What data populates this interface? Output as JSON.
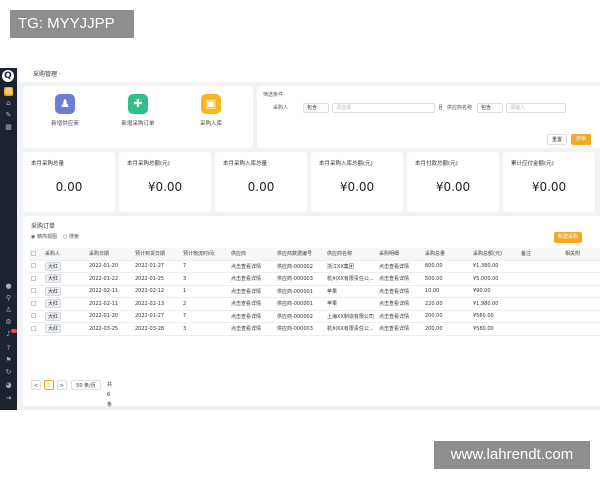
{
  "watermarks": {
    "top_left": "TG: MYYJJPP",
    "bottom_right": "www.lahrendt.com"
  },
  "colors": {
    "accent": "#f5a623",
    "rail": "#1b2230",
    "shortcut_purple": "#6c7dd4",
    "shortcut_green": "#2fbf8a",
    "shortcut_yellow": "#f5b821"
  },
  "rail_icons": [
    "logo-icon",
    "doc-icon",
    "home-icon",
    "edit-icon",
    "grid-icon",
    "circle-icon",
    "search-icon",
    "user-icon",
    "settings-icon",
    "bell-icon",
    "help-icon",
    "flag-icon",
    "refresh-icon",
    "avatar-icon",
    "logout-icon"
  ],
  "page": {
    "title": "采购管理 ·"
  },
  "shortcuts": [
    {
      "label": "新增供应商",
      "icon": "user-icon"
    },
    {
      "label": "新增采购订单",
      "icon": "cart-icon"
    },
    {
      "label": "采购入库",
      "icon": "truck-icon"
    }
  ],
  "filters": {
    "header": "筛选条件",
    "purchaser_label": "采购人",
    "purchaser_op": "包含",
    "purchaser_placeholder": "请选择",
    "and_label": "且",
    "supplier_label": "供应商名称",
    "supplier_op": "包含",
    "supplier_placeholder": "请输入",
    "reset": "重置",
    "search": "搜索"
  },
  "kpis": [
    {
      "title": "本月采购总量",
      "value": "0.00"
    },
    {
      "title": "本月采购总额(元)",
      "value": "¥0.00"
    },
    {
      "title": "本月采购入库总量",
      "value": "0.00"
    },
    {
      "title": "本月采购入库总额(元)",
      "value": "¥0.00"
    },
    {
      "title": "本月付款总额(元)",
      "value": "¥0.00"
    },
    {
      "title": "累计应付金额(元)",
      "value": "¥0.00"
    }
  ],
  "orders": {
    "title": "采购订单",
    "view_label": "◉ 精简视图",
    "search_label": "○ 搜索",
    "new_button": "新建采购",
    "columns": [
      "",
      "采购人",
      "采购日期",
      "预计到货日期",
      "预计物流时间(",
      "供应商",
      "供应商数据编号",
      "供应商名称",
      "采购明细",
      "采购总量",
      "采购总额(元)",
      "备注",
      "相关附"
    ],
    "rows": [
      {
        "buyer": "大红",
        "date": "2022-01-20",
        "eta": "2022-01-27",
        "days": "7",
        "supplier": "点击查看详情",
        "code": "供应商-000002",
        "name": "浙江XX集团",
        "detail": "点击查看详情",
        "qty": "600.00",
        "amount": "¥1,380.00"
      },
      {
        "buyer": "大红",
        "date": "2022-01-22",
        "eta": "2022-01-25",
        "days": "3",
        "supplier": "点击查看详情",
        "code": "供应商-000003",
        "name": "杭州XX有限责任公...",
        "detail": "点击查看详情",
        "qty": "500.00",
        "amount": "¥5,000.00"
      },
      {
        "buyer": "大红",
        "date": "2022-02-11",
        "eta": "2022-02-12",
        "days": "1",
        "supplier": "点击查看详情",
        "code": "供应商-000001",
        "name": "苹果",
        "detail": "点击查看详情",
        "qty": "10.00",
        "amount": "¥90.00"
      },
      {
        "buyer": "大红",
        "date": "2022-02-11",
        "eta": "2022-02-13",
        "days": "2",
        "supplier": "点击查看详情",
        "code": "供应商-000001",
        "name": "苹果",
        "detail": "点击查看详情",
        "qty": "220.00",
        "amount": "¥1,980.00"
      },
      {
        "buyer": "大红",
        "date": "2022-01-20",
        "eta": "2022-01-27",
        "days": "7",
        "supplier": "点击查看详情",
        "code": "供应商-000002",
        "name": "上海XX制造有限公司",
        "detail": "点击查看详情",
        "qty": "200.00",
        "amount": "¥560.00"
      },
      {
        "buyer": "大红",
        "date": "2022-03-25",
        "eta": "2022-03-28",
        "days": "3",
        "supplier": "点击查看详情",
        "code": "供应商-000003",
        "name": "杭州XX有限责任公...",
        "detail": "点击查看详情",
        "qty": "200.00",
        "amount": "¥580.00"
      }
    ]
  },
  "pager": {
    "prev": "<",
    "current": "1",
    "next": ">",
    "page_size": "50 条/页",
    "total": "共 6 条"
  }
}
